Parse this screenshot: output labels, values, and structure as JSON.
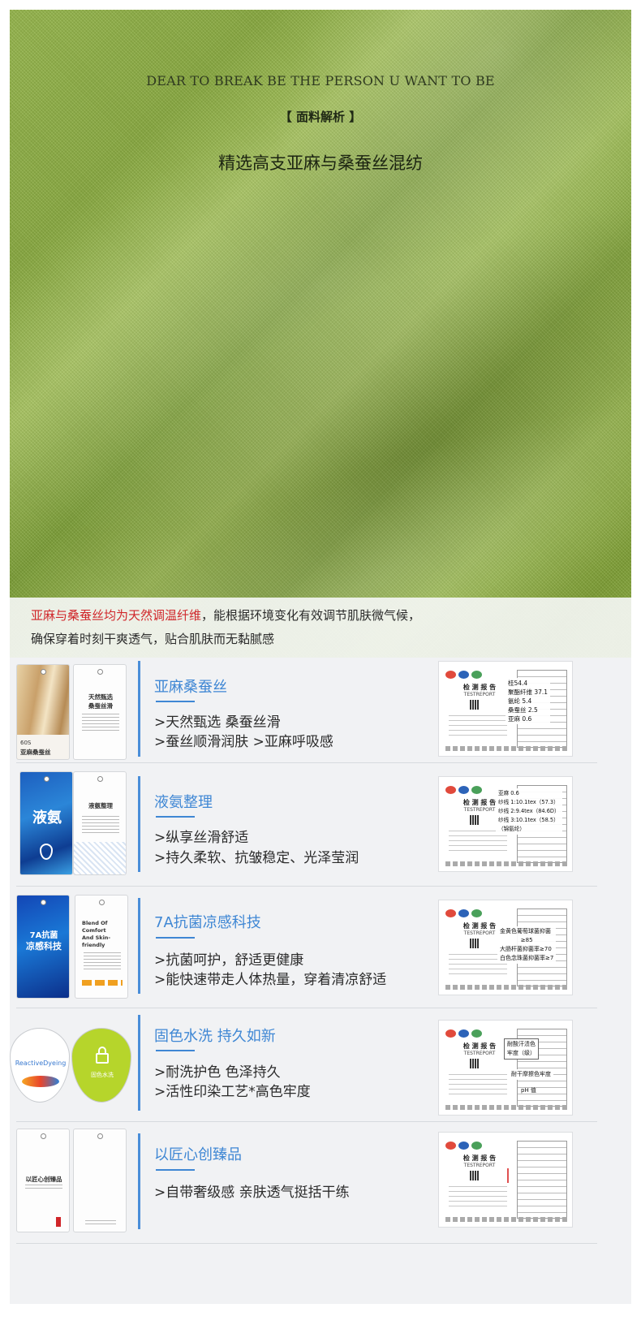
{
  "hero": {
    "tagline": "DEAR TO BREAK BE THE PERSON U WANT TO BE",
    "section_label": "【  面料解析  】",
    "title": "精选高支亚麻与桑蚕丝混纺"
  },
  "intro": {
    "highlight": "亚麻与桑蚕丝均为天然调温纤维",
    "line1_rest": "，能根据环境变化有效调节肌肤微气候，",
    "line2": "确保穿着时刻干爽透气，贴合肌肤而无黏腻感"
  },
  "colors": {
    "accent": "#3f87d4",
    "highlight_red": "#d0262a",
    "fabric_green": "#8fb046"
  },
  "features": [
    {
      "title": "亚麻桑蚕丝",
      "lines": [
        ">天然甄选 桑蚕丝滑",
        ">蚕丝顺滑润肤 >亚麻呼吸感"
      ],
      "tags": [
        "60S",
        "亚麻桑蚕丝",
        "天然甄选",
        "桑蚕丝滑"
      ],
      "report": {
        "title": "检 测 报 告",
        "subtitle": "TESTREPORT",
        "overlay": [
          "桂54.4",
          "聚酯纤维 37.1",
          "氨纶 5.4",
          "桑蚕丝 2.5",
          "亚麻 0.6"
        ]
      }
    },
    {
      "title": "液氨整理",
      "lines": [
        ">纵享丝滑舒适",
        ">持久柔软、抗皱稳定、光泽莹润"
      ],
      "tags": [
        "液氨",
        "液氨整理"
      ],
      "report": {
        "title": "检 测 报 告",
        "subtitle": "TESTREPORT",
        "overlay": [
          "亚麻 0.6",
          "纱线 1:10.1tex（57.3）",
          "纱线 2:9.4tex（84.6D）",
          "纱线 3:10.1tex（58.5）",
          "（锦氨纶）"
        ]
      }
    },
    {
      "title": "7A抗菌凉感科技",
      "lines": [
        ">抗菌呵护，舒适更健康",
        ">能快速带走人体热量，穿着清凉舒适"
      ],
      "tags": [
        "7A抗菌",
        "凉感科技",
        "Blend Of Comfort And Skin-friendly"
      ],
      "report": {
        "title": "检 测 报 告",
        "subtitle": "TESTREPORT",
        "overlay": [
          "金黄色葡萄球菌抑菌",
          "≥85",
          "大肠杆菌抑菌率≥70",
          "白色念珠菌抑菌率≥7"
        ]
      }
    },
    {
      "title": "固色水洗 持久如新",
      "lines": [
        ">耐洗护色 色泽持久",
        ">活性印染工艺*高色牢度"
      ],
      "tags": [
        "ReactiveDyeing",
        "固色水洗"
      ],
      "report": {
        "title": "检 测 报 告",
        "subtitle": "TESTREPORT",
        "overlay": [
          "耐酸汗渍色",
          "牢度（级）",
          "耐干摩擦色牢度",
          "pH 值"
        ]
      }
    },
    {
      "title": "以匠心创臻品",
      "lines": [
        ">自带奢级感 亲肤透气挺括干练"
      ],
      "tags": [
        "以匠心创臻品"
      ],
      "report": {
        "title": "检 测 报 告",
        "subtitle": "TESTREPORT",
        "overlay": []
      }
    }
  ]
}
